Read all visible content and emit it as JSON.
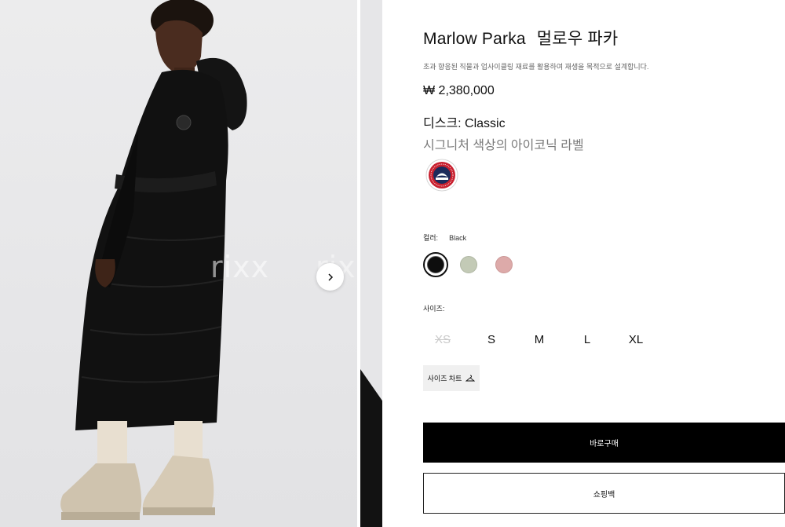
{
  "gallery": {
    "watermarks": [
      "rixx",
      "rixx"
    ],
    "next_arrow_icon": "chevron-right-icon"
  },
  "product": {
    "title_en": "Marlow Parka",
    "title_ko": "멀로우 파카",
    "description": "초과 향응된 직물과 업사이클링 재료를 활용하여 재생을 목적으로 설계합니다.",
    "price": "₩ 2,380,000",
    "disc_label": "디스크: Classic",
    "disc_sub": "시그니처 색상의 아이코닉 라벨",
    "badge_icon": "canada-goose-disc-icon"
  },
  "color": {
    "label": "컬러:",
    "selected": "Black",
    "swatches": [
      {
        "name": "Black",
        "hex": "#0e0e0e"
      },
      {
        "name": "Sage",
        "hex": "#c3cab6"
      },
      {
        "name": "Rose",
        "hex": "#ddaaa9"
      }
    ]
  },
  "size": {
    "label": "사이즈:",
    "options": [
      {
        "label": "XS",
        "available": false
      },
      {
        "label": "S",
        "available": true
      },
      {
        "label": "M",
        "available": true
      },
      {
        "label": "L",
        "available": true
      },
      {
        "label": "XL",
        "available": true
      }
    ],
    "chart_label": "사이즈 차트",
    "chart_icon": "hanger-icon"
  },
  "actions": {
    "buy_now": "바로구매",
    "shopping_bag": "쇼핑백"
  },
  "colors": {
    "buy_button_bg": "#000000",
    "page_bg": "#ffffff",
    "photo_bg": "#e8e8ea"
  }
}
